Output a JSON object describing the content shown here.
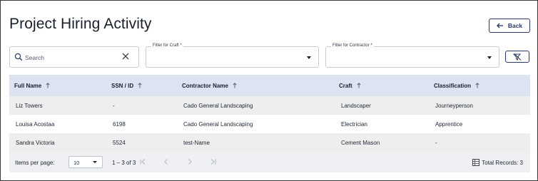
{
  "page": {
    "title": "Project Hiring Activity",
    "back_label": "Back"
  },
  "filters": {
    "search_placeholder": "Search",
    "craft_label": "Filter for Craft *",
    "craft_value": "",
    "contractor_label": "Filter for Contractor *",
    "contractor_value": ""
  },
  "table": {
    "columns": [
      "Full Name",
      "SSN / ID",
      "Contractor Name",
      "Craft",
      "Classification"
    ],
    "rows": [
      [
        "Liz Towers",
        "-",
        "Cado General Landscaping",
        "Landscaper",
        "Journeyperson"
      ],
      [
        "Louisa Acostaa",
        "6198",
        "Cado General Landscaping",
        "Electrician",
        "Apprentice"
      ],
      [
        "Sandra Victoria",
        "5524",
        "test-Name",
        "Cement Mason",
        "-"
      ]
    ]
  },
  "pagination": {
    "items_per_page_label": "Items per page:",
    "items_per_page": "10",
    "range": "1 – 3 of 3",
    "total_records": "Total Records: 3"
  },
  "icons": [
    "arrow-left-icon",
    "search-icon",
    "close-icon",
    "filter-clear-icon",
    "sort-arrow-icon",
    "first-page-icon",
    "prev-page-icon",
    "next-page-icon",
    "last-page-icon",
    "table-icon"
  ],
  "colors": {
    "accent": "#2b3a67",
    "header_bg": "#dde3f0",
    "odd_row": "#eeeeee",
    "footer_bg": "#eef0f4"
  }
}
